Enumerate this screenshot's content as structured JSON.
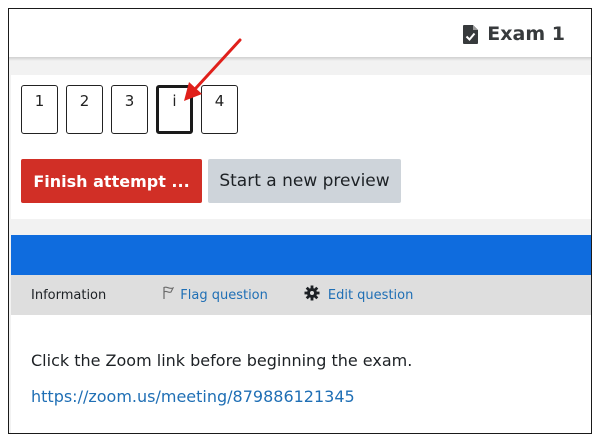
{
  "header": {
    "exam_title": "Exam 1",
    "icon": "document-check-icon"
  },
  "navigation": {
    "questions": [
      {
        "label": "1",
        "current": false
      },
      {
        "label": "2",
        "current": false
      },
      {
        "label": "3",
        "current": false
      },
      {
        "label": "i",
        "current": true
      },
      {
        "label": "4",
        "current": false
      }
    ],
    "finish_label": "Finish attempt ...",
    "preview_label": "Start a new preview"
  },
  "question_bar": {
    "info_label": "Information",
    "flag_label": "Flag question",
    "flag_icon": "flag-icon",
    "edit_label": "Edit question",
    "edit_icon": "gear-icon"
  },
  "content": {
    "text": "Click the Zoom link before beginning the exam.",
    "link": "https://zoom.us/meeting/879886121345"
  },
  "annotation": {
    "arrow_color": "#e0201b"
  },
  "colors": {
    "finish_button": "#d12f26",
    "preview_button": "#ced4da",
    "blue_bar": "#0f6cde",
    "link": "#1f6fb5"
  }
}
